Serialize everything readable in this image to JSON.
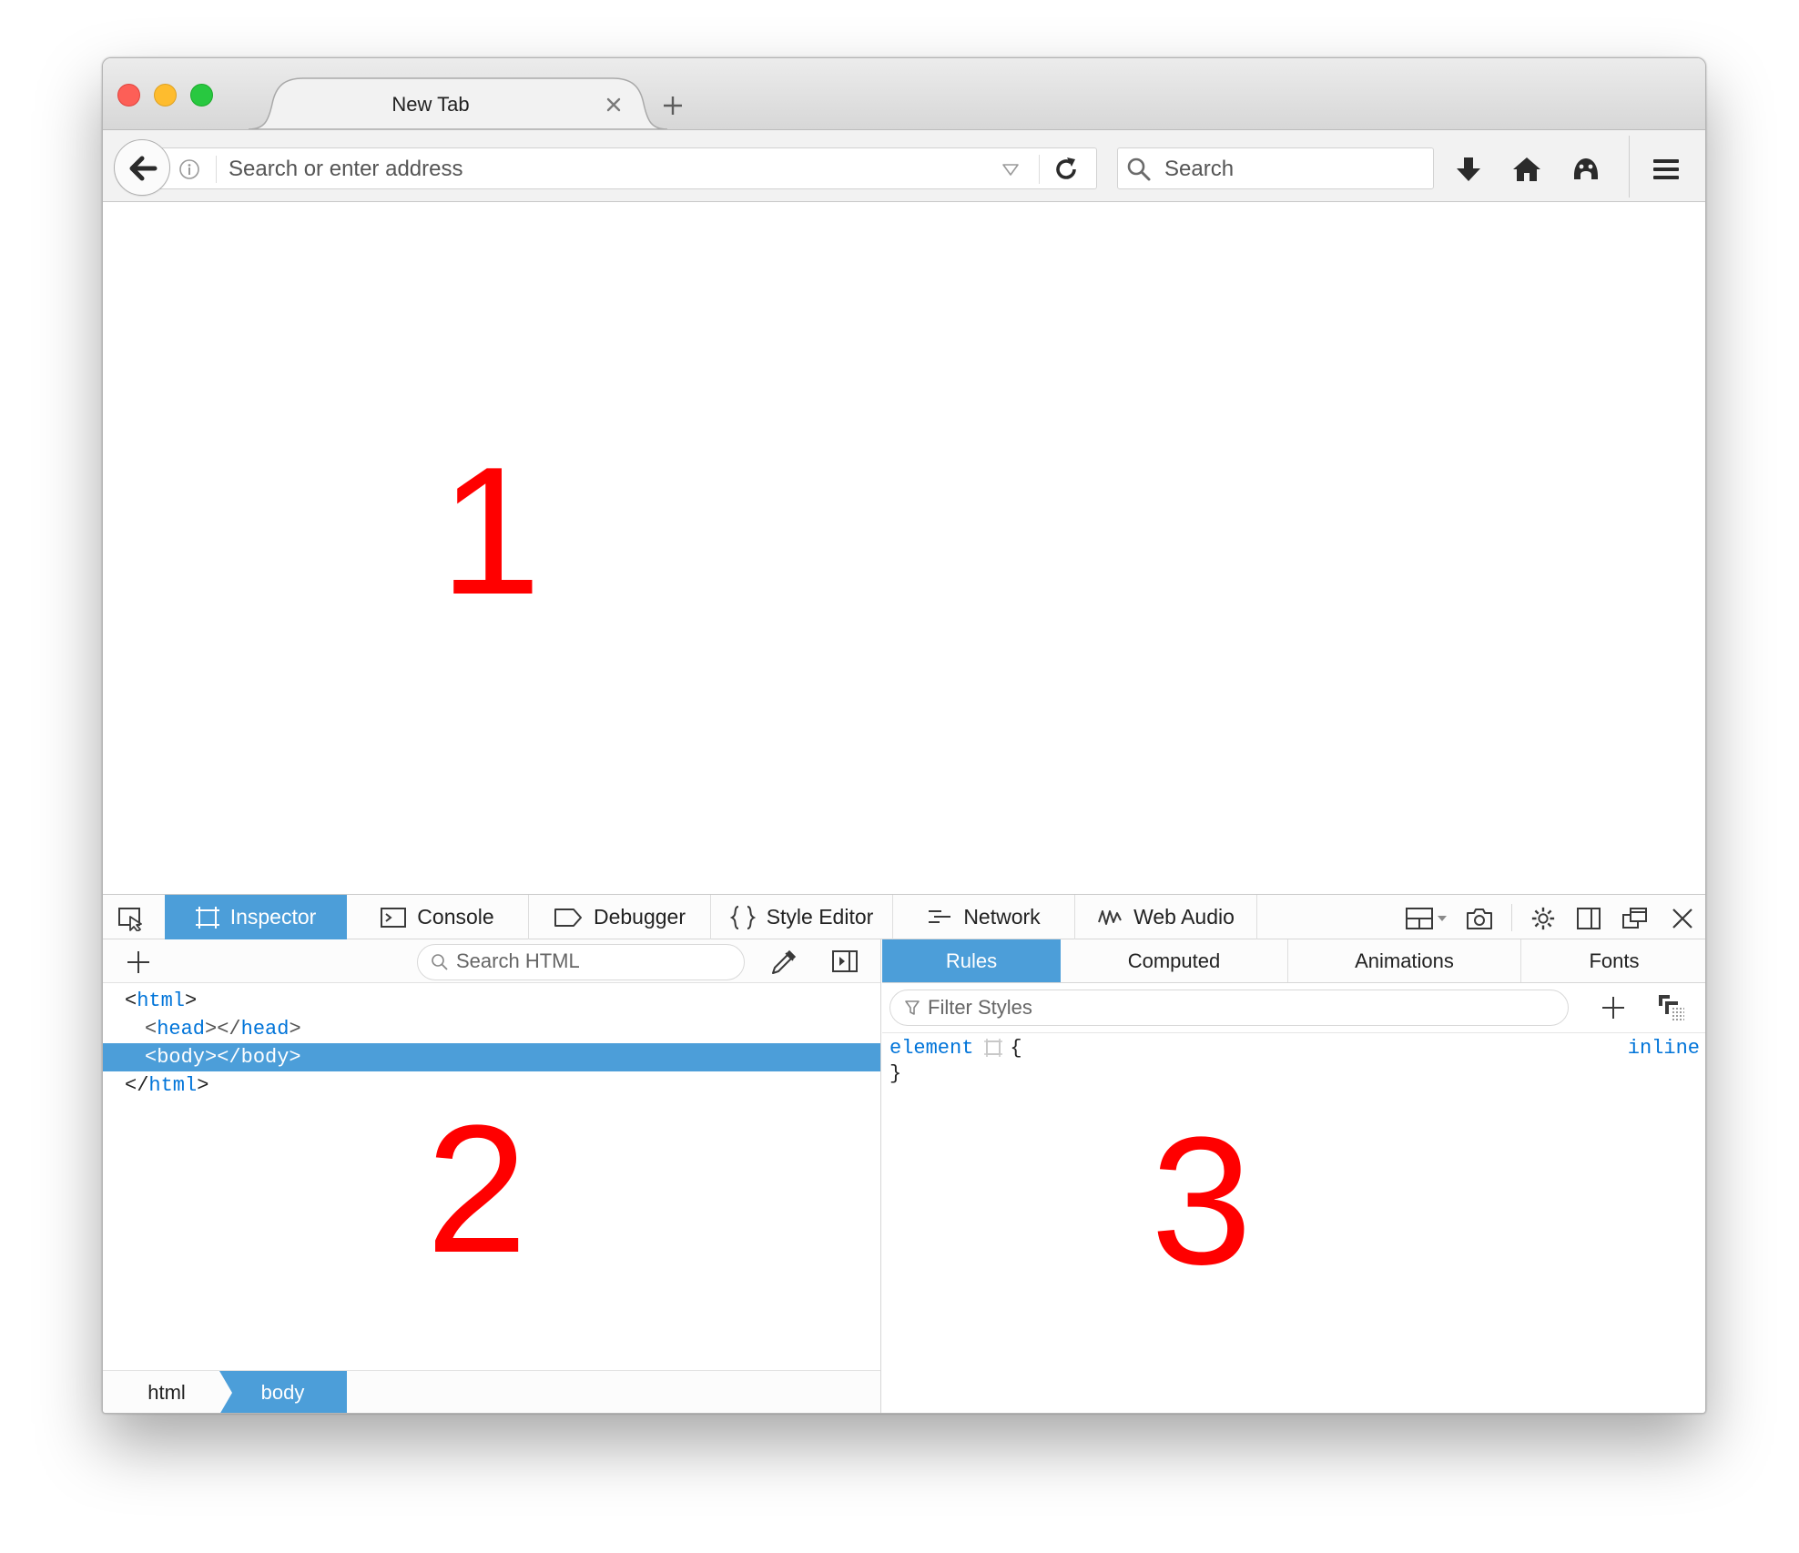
{
  "browser": {
    "tab_title": "New Tab",
    "address_placeholder": "Search or enter address",
    "search_placeholder": "Search"
  },
  "content": {
    "annotation_1": "1"
  },
  "devtools": {
    "tabs": [
      {
        "label": "Inspector",
        "icon": "inspector-icon"
      },
      {
        "label": "Console",
        "icon": "console-icon"
      },
      {
        "label": "Debugger",
        "icon": "debugger-icon"
      },
      {
        "label": "Style Editor",
        "icon": "style-editor-icon"
      },
      {
        "label": "Network",
        "icon": "network-icon"
      },
      {
        "label": "Web Audio",
        "icon": "web-audio-icon"
      }
    ],
    "selected_tab": "Inspector",
    "markup": {
      "search_placeholder": "Search HTML",
      "nodes": {
        "html_open_lt": "<",
        "html_tag": "html",
        "gt": ">",
        "head_lt": "<",
        "head_tag": "head",
        "head_mid": "></",
        "head_close_tag": "head",
        "head_gt": ">",
        "body_row": "<body></body>",
        "html_close_lt": "</",
        "html_close_tag": "html",
        "html_close_gt": ">"
      },
      "breadcrumbs": [
        "html",
        "body"
      ]
    },
    "annotation_2": "2",
    "rules": {
      "tabs": [
        "Rules",
        "Computed",
        "Animations",
        "Fonts"
      ],
      "selected_tab": "Rules",
      "filter_placeholder": "Filter Styles",
      "rule": {
        "selector": "element",
        "open_brace": "{",
        "close_brace": "}",
        "source": "inline"
      }
    },
    "annotation_3": "3"
  },
  "colors": {
    "accent": "#4c9ed9",
    "tag": "#0074d9",
    "annotation": "#ff0000"
  }
}
